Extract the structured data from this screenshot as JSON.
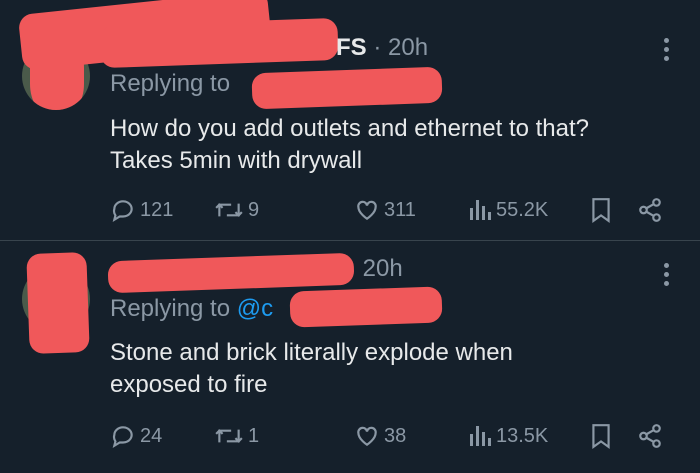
{
  "tweets": [
    {
      "handle_suffix": "FS",
      "separator": "·",
      "time": "20h",
      "replying_to_label": "Replying to",
      "replying_to_mention": "",
      "text_lines": [
        "How do you add outlets and ethernet to that?",
        "Takes 5min with drywall"
      ],
      "actions": {
        "replies": "121",
        "retweets": "9",
        "likes": "311",
        "views": "55.2K"
      },
      "icons": [
        "reply-icon",
        "retweet-icon",
        "like-icon",
        "views-icon",
        "bookmark-icon",
        "share-icon",
        "more-icon"
      ]
    },
    {
      "handle_suffix": "",
      "separator": "",
      "time": "20h",
      "replying_to_label": "Replying to",
      "replying_to_mention": "@c",
      "text_lines": [
        "Stone and brick literally explode when",
        "exposed to fire"
      ],
      "actions": {
        "replies": "24",
        "retweets": "1",
        "likes": "38",
        "views": "13.5K"
      },
      "icons": [
        "reply-icon",
        "retweet-icon",
        "like-icon",
        "views-icon",
        "bookmark-icon",
        "share-icon",
        "more-icon"
      ]
    }
  ],
  "colors": {
    "background": "#15202b",
    "text_primary": "#e7e9ea",
    "text_secondary": "#8b98a5",
    "mention": "#1d9bf0",
    "redaction": "#f0585a",
    "divider": "#38444d"
  }
}
